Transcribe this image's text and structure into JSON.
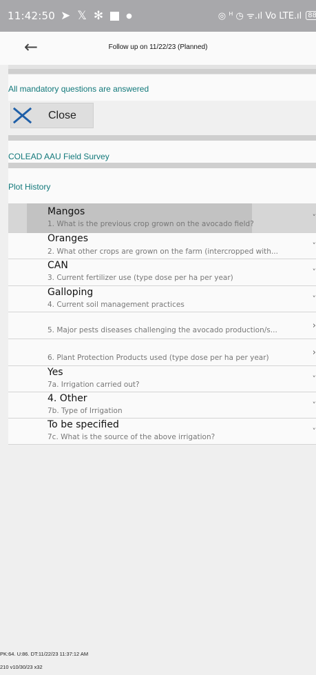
{
  "status_bar": {
    "time": "11:42:50",
    "left_icons": [
      "paper-plane-icon",
      "x-icon",
      "bluetooth-icon",
      "square-icon",
      "dot-icon"
    ],
    "right_text": "◎ ᵸ ◷ ᯤ.ıl Vo LTE.ıl",
    "battery": "88"
  },
  "header": {
    "title": "Follow up on 11/22/23 (Planned)"
  },
  "status_message": "All mandatory questions are answered",
  "close_button": {
    "label": "Close"
  },
  "survey_name": "COLEAD AAU Field Survey",
  "section_title": "Plot History",
  "questions": [
    {
      "answer": "Mangos",
      "question": "1. What is the previous crop grown on the avocado field?",
      "chevron": "˅"
    },
    {
      "answer": "Oranges",
      "question": "2. What other crops are grown on the farm (intercropped with...",
      "chevron": "˅"
    },
    {
      "answer": "CAN",
      "question": "3. Current fertilizer use (type  dose per ha per year)",
      "chevron": "˅"
    },
    {
      "answer": "Galloping",
      "question": "4. Current soil management practices",
      "chevron": "˅"
    },
    {
      "answer": "",
      "question": "5. Major pests  diseases challenging the avocado production/s...",
      "chevron": "›"
    },
    {
      "answer": "",
      "question": "6. Plant Protection Products used (type  dose per ha per year)",
      "chevron": "›"
    },
    {
      "answer": "Yes",
      "question": "7a. Irrigation carried out?",
      "chevron": "˅"
    },
    {
      "answer": "4. Other",
      "question": "7b. Type of Irrigation",
      "chevron": "˅"
    },
    {
      "answer": "To be specified",
      "question": "7c. What is the source of the above irrigation?",
      "chevron": "˅"
    }
  ],
  "footer": {
    "line1": "PK:64. U:86. DT:11/22/23 11:37:12 AM",
    "line2": "210 v10/30/23 x32"
  }
}
